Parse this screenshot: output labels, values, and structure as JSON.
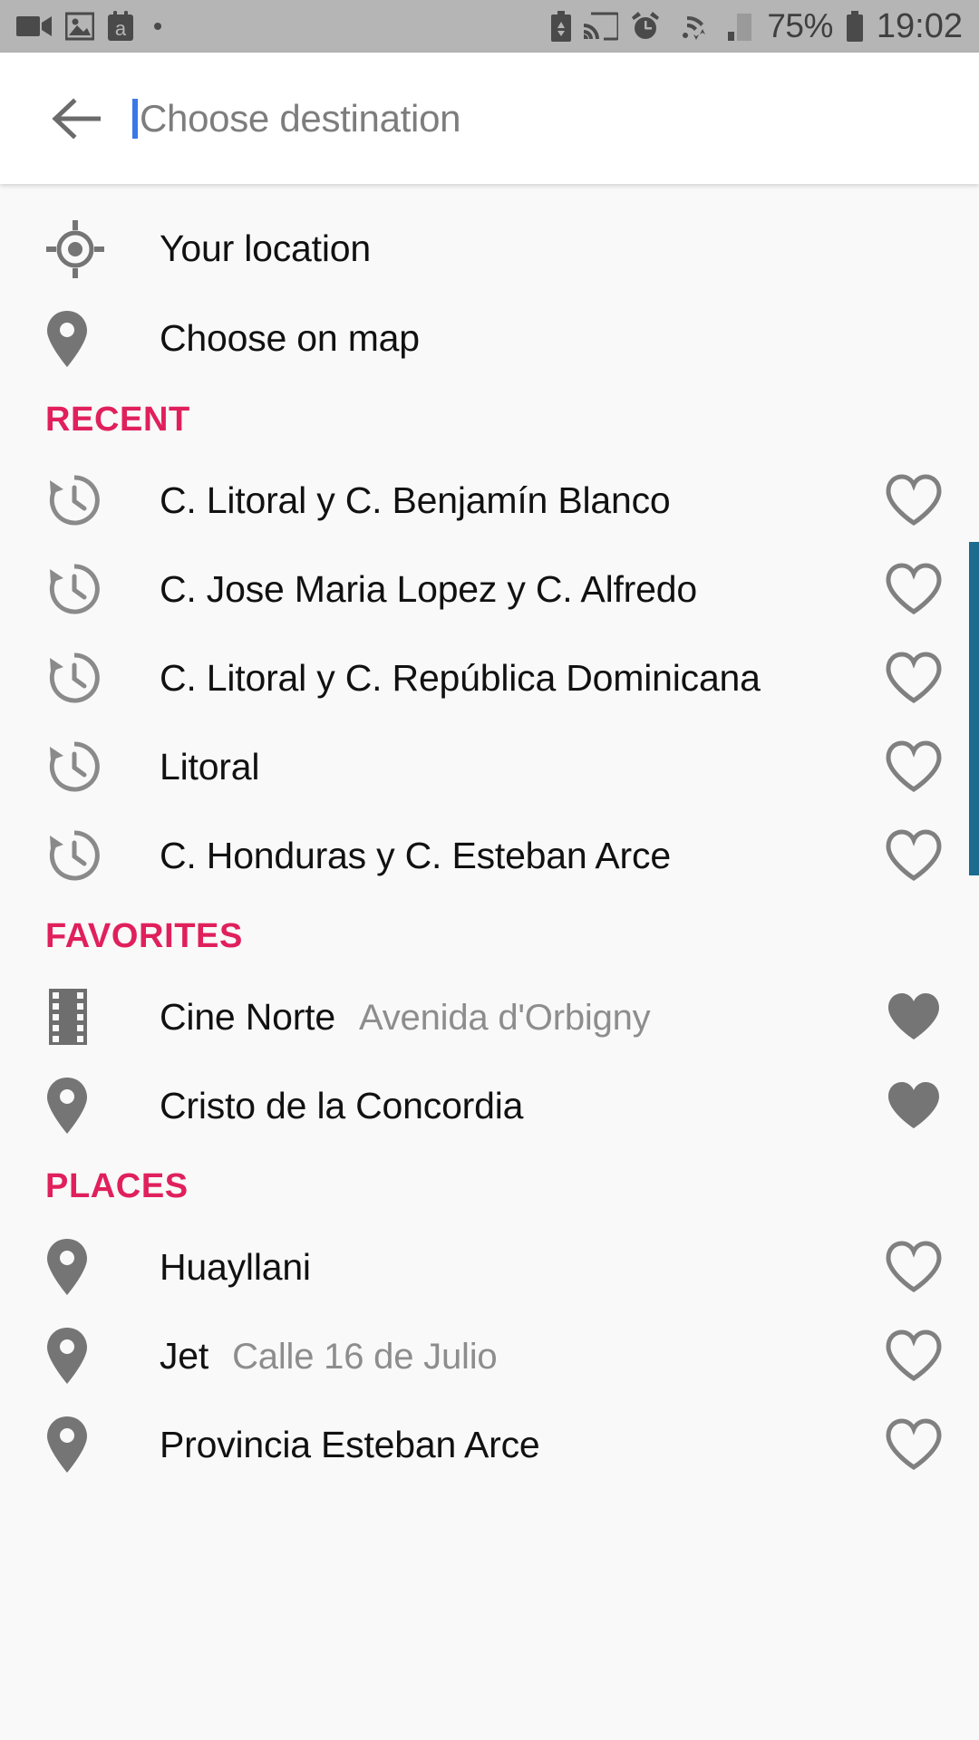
{
  "status_bar": {
    "left_icons": [
      "video-camera-icon",
      "photo-image-icon",
      "aptoide-a-icon",
      "small-dot-icon"
    ],
    "right_icons": [
      "battery-saver-icon",
      "cast-screen-icon",
      "alarm-clock-icon",
      "wifi-transfer-icon",
      "cellular-signal-icon"
    ],
    "battery_percent": "75%",
    "time": "19:02",
    "background_color": "#b5b5b5",
    "icon_color": "#4a4a4a"
  },
  "search": {
    "back_icon": "back-arrow-icon",
    "placeholder": "Choose destination",
    "value": "",
    "caret_color": "#3b78e7"
  },
  "quick_actions": [
    {
      "label": "Your location",
      "icon": "my-location-crosshair-icon"
    },
    {
      "label": "Choose on map",
      "icon": "map-pin-icon"
    }
  ],
  "sections": [
    {
      "title": "RECENT",
      "color": "#e0205c",
      "items": [
        {
          "label": "C. Litoral y C. Benjamín Blanco",
          "sub": "",
          "icon": "history-clock-icon",
          "favorite": false
        },
        {
          "label": "C. Jose Maria Lopez y C. Alfredo",
          "sub": "",
          "icon": "history-clock-icon",
          "favorite": false
        },
        {
          "label": "C. Litoral y C. República Dominicana",
          "sub": "",
          "icon": "history-clock-icon",
          "favorite": false
        },
        {
          "label": "Litoral",
          "sub": "",
          "icon": "history-clock-icon",
          "favorite": false
        },
        {
          "label": "C. Honduras y C. Esteban Arce",
          "sub": "",
          "icon": "history-clock-icon",
          "favorite": false
        }
      ]
    },
    {
      "title": "FAVORITES",
      "color": "#e0205c",
      "items": [
        {
          "label": "Cine Norte",
          "sub": "Avenida d'Orbigny",
          "icon": "film-strip-icon",
          "favorite": true
        },
        {
          "label": "Cristo de la Concordia",
          "sub": "",
          "icon": "map-pin-icon",
          "favorite": true
        }
      ]
    },
    {
      "title": "PLACES",
      "color": "#e0205c",
      "items": [
        {
          "label": "Huayllani",
          "sub": "",
          "icon": "map-pin-icon",
          "favorite": false
        },
        {
          "label": "Jet",
          "sub": "Calle 16 de Julio",
          "icon": "map-pin-icon",
          "favorite": false
        },
        {
          "label": "Provincia Esteban Arce",
          "sub": "",
          "icon": "map-pin-icon",
          "favorite": false
        }
      ]
    }
  ],
  "scrollbar": {
    "color": "#1b6c8e"
  }
}
